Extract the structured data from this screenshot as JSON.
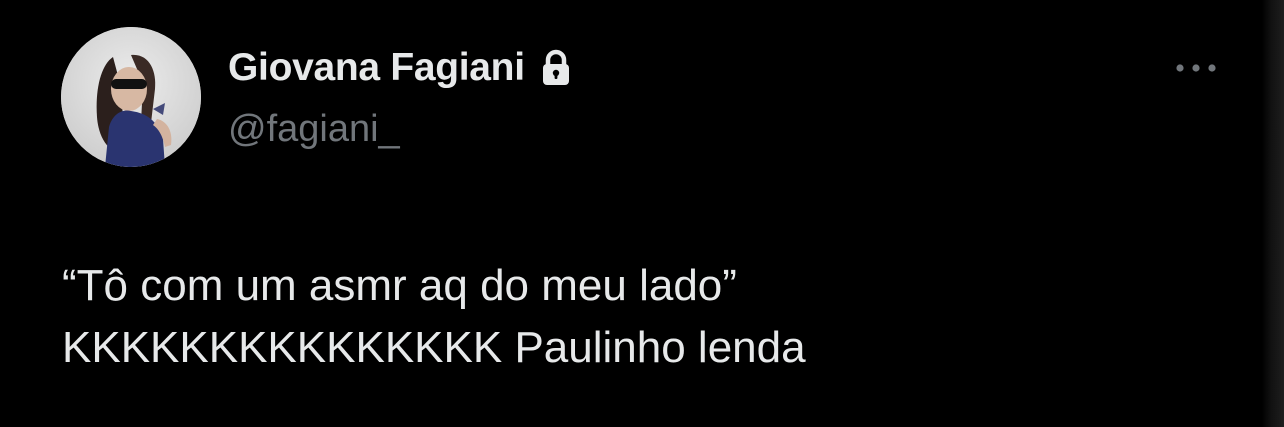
{
  "author": {
    "display_name": "Giovana Fagiani",
    "handle": "@fagiani_",
    "protected": true,
    "avatar_description_icon": "avatar-photo",
    "lock_icon": "lock-icon"
  },
  "tweet": {
    "lines": [
      "“Tô com um asmr aq do meu lado”",
      "KKKKKKKKKKKKKKK Paulinho lenda"
    ]
  },
  "actions": {
    "more_icon": "more-horizontal-icon"
  },
  "colors": {
    "background": "#000000",
    "primary_text": "#e7e9ea",
    "secondary_text": "#71767b"
  }
}
